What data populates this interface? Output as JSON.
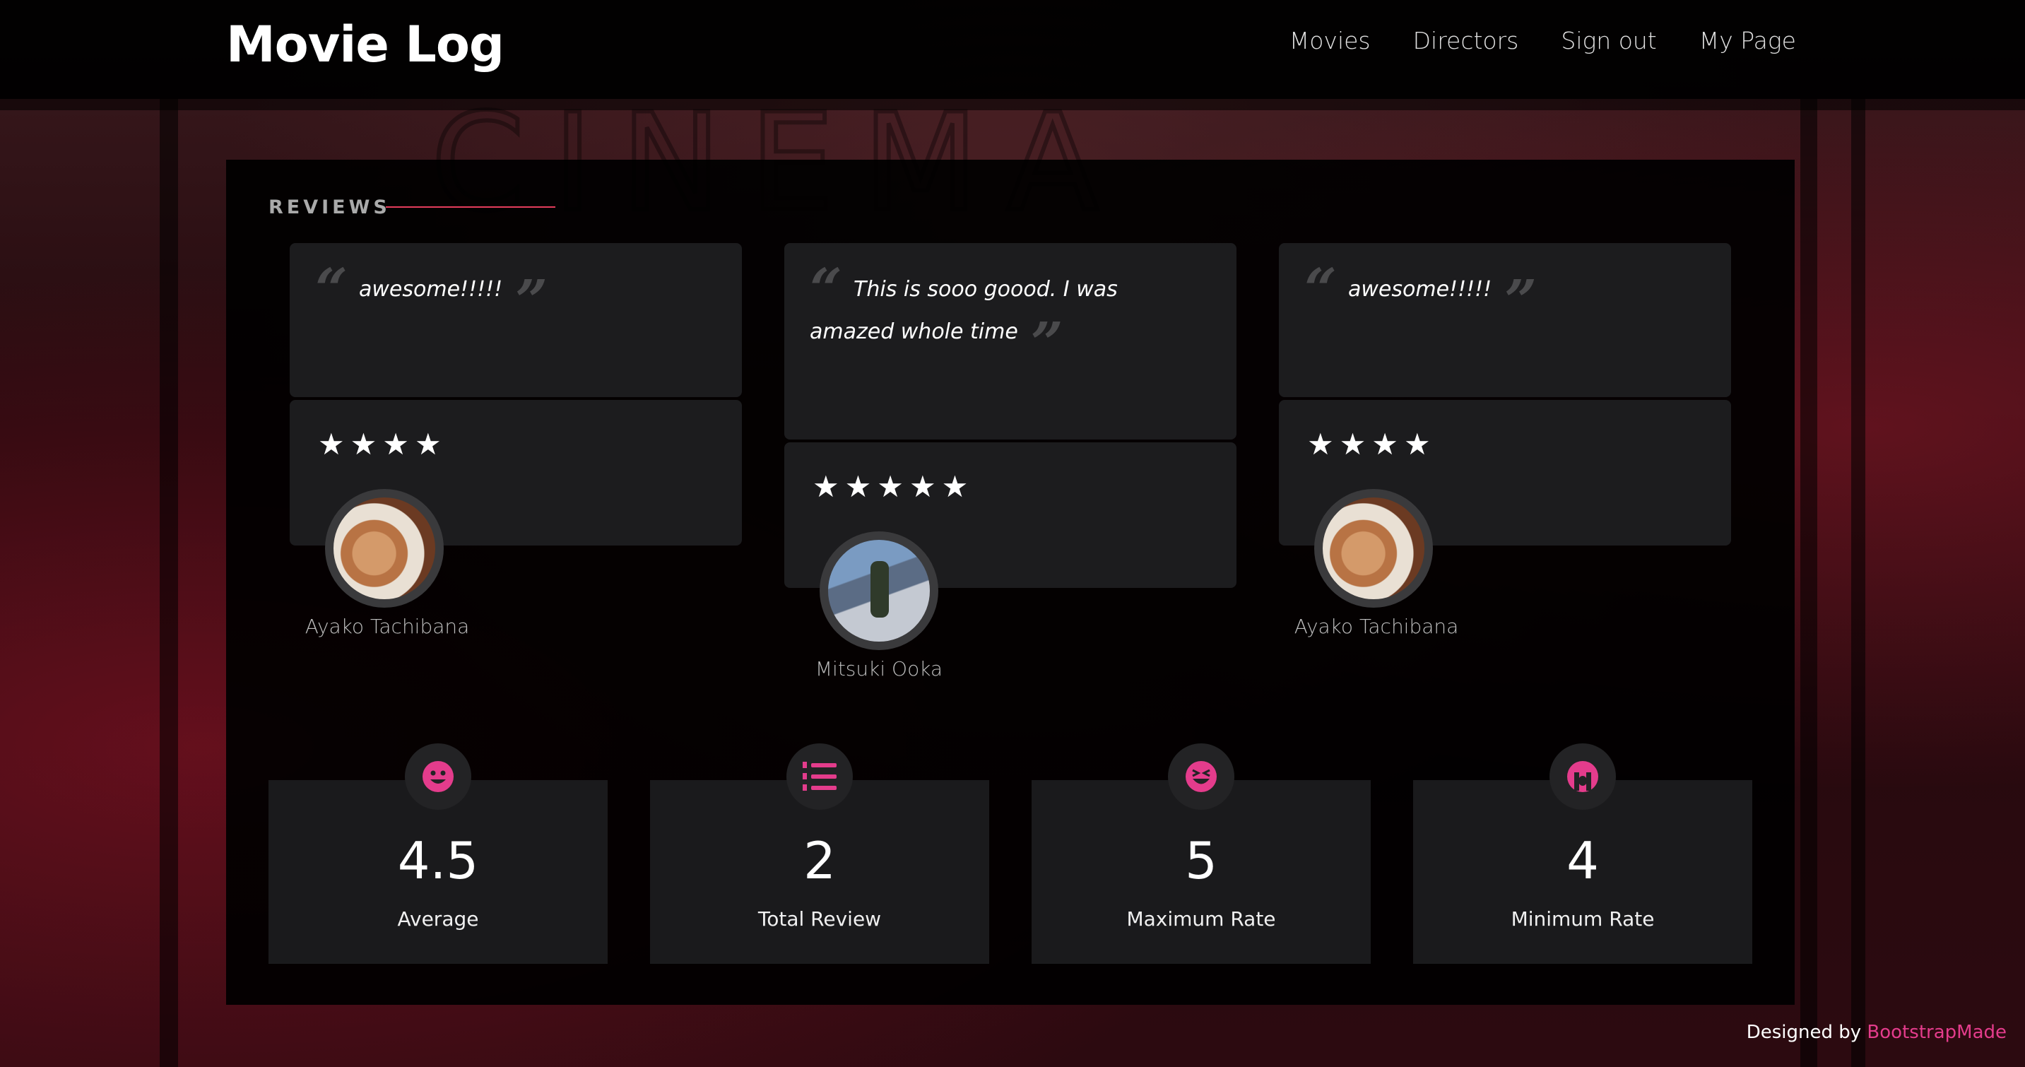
{
  "header": {
    "brand": "Movie Log",
    "nav": [
      "Movies",
      "Directors",
      "Sign out",
      "My Page"
    ]
  },
  "reviews_section": {
    "title": "REVIEWS",
    "reviews": [
      {
        "text": "awesome!!!!!",
        "stars": "★★★★",
        "rating": 4,
        "reviewer": "Ayako Tachibana"
      },
      {
        "text": "This is sooo goood. I was amazed whole time",
        "stars": "★★★★★",
        "rating": 5,
        "reviewer": "Mitsuki Ooka"
      },
      {
        "text": "awesome!!!!!",
        "stars": "★★★★",
        "rating": 4,
        "reviewer": "Ayako Tachibana"
      }
    ]
  },
  "stats": [
    {
      "value": "4.5",
      "label": "Average",
      "icon": "smile-icon"
    },
    {
      "value": "2",
      "label": "Total Review",
      "icon": "list-ol-icon"
    },
    {
      "value": "5",
      "label": "Maximum Rate",
      "icon": "laugh-squint-icon"
    },
    {
      "value": "4",
      "label": "Minimum Rate",
      "icon": "sad-cry-icon"
    }
  ],
  "footer": {
    "prefix": "Designed by",
    "link": "BootstrapMade"
  },
  "colors": {
    "accent": "#e43c8c",
    "panel": "#000000",
    "card": "#1c1c1e"
  }
}
